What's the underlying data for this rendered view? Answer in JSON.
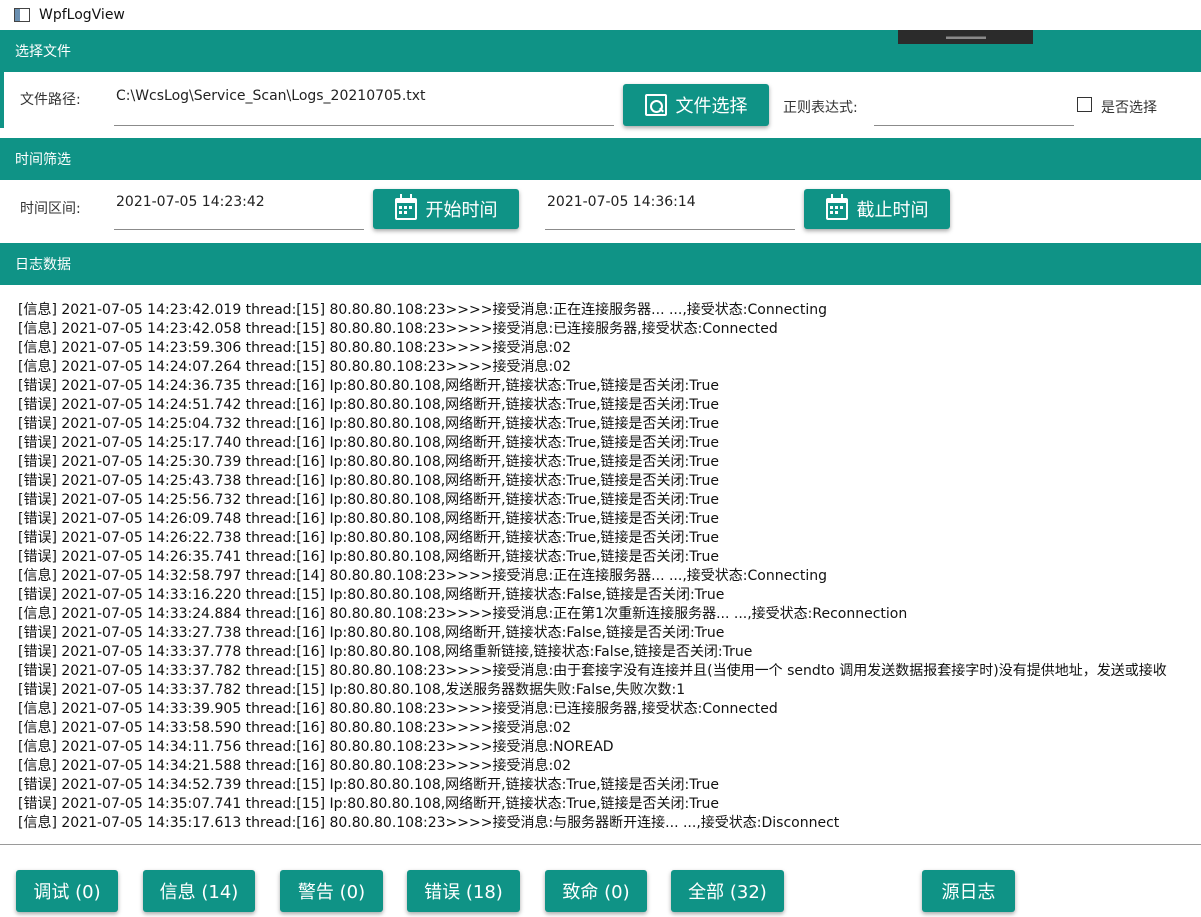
{
  "window": {
    "title": "WpfLogView"
  },
  "sections": {
    "file": "选择文件",
    "time": "时间筛选",
    "log": "日志数据"
  },
  "file_select": {
    "path_label": "文件路径:",
    "path_value": "C:\\WcsLog\\Service_Scan\\Logs_20210705.txt",
    "button": "文件选择",
    "regex_label": "正则表达式:",
    "regex_value": "",
    "checkbox_label": "是否选择"
  },
  "time_filter": {
    "range_label": "时间区间:",
    "start_value": "2021-07-05 14:23:42",
    "start_button": "开始时间",
    "end_value": "2021-07-05 14:36:14",
    "end_button": "截止时间"
  },
  "log_lines": [
    "[信息] 2021-07-05 14:23:42.019 thread:[15] 80.80.80.108:23>>>>接受消息:正在连接服务器... ...,接受状态:Connecting",
    "[信息] 2021-07-05 14:23:42.058 thread:[15] 80.80.80.108:23>>>>接受消息:已连接服务器,接受状态:Connected",
    "[信息] 2021-07-05 14:23:59.306 thread:[15] 80.80.80.108:23>>>>接受消息:02",
    "[信息] 2021-07-05 14:24:07.264 thread:[15] 80.80.80.108:23>>>>接受消息:02",
    "[错误] 2021-07-05 14:24:36.735 thread:[16] Ip:80.80.80.108,网络断开,链接状态:True,链接是否关闭:True",
    "[错误] 2021-07-05 14:24:51.742 thread:[16] Ip:80.80.80.108,网络断开,链接状态:True,链接是否关闭:True",
    "[错误] 2021-07-05 14:25:04.732 thread:[16] Ip:80.80.80.108,网络断开,链接状态:True,链接是否关闭:True",
    "[错误] 2021-07-05 14:25:17.740 thread:[16] Ip:80.80.80.108,网络断开,链接状态:True,链接是否关闭:True",
    "[错误] 2021-07-05 14:25:30.739 thread:[16] Ip:80.80.80.108,网络断开,链接状态:True,链接是否关闭:True",
    "[错误] 2021-07-05 14:25:43.738 thread:[16] Ip:80.80.80.108,网络断开,链接状态:True,链接是否关闭:True",
    "[错误] 2021-07-05 14:25:56.732 thread:[16] Ip:80.80.80.108,网络断开,链接状态:True,链接是否关闭:True",
    "[错误] 2021-07-05 14:26:09.748 thread:[16] Ip:80.80.80.108,网络断开,链接状态:True,链接是否关闭:True",
    "[错误] 2021-07-05 14:26:22.738 thread:[16] Ip:80.80.80.108,网络断开,链接状态:True,链接是否关闭:True",
    "[错误] 2021-07-05 14:26:35.741 thread:[16] Ip:80.80.80.108,网络断开,链接状态:True,链接是否关闭:True",
    "[信息] 2021-07-05 14:32:58.797 thread:[14] 80.80.80.108:23>>>>接受消息:正在连接服务器... ...,接受状态:Connecting",
    "[错误] 2021-07-05 14:33:16.220 thread:[15] Ip:80.80.80.108,网络断开,链接状态:False,链接是否关闭:True",
    "[信息] 2021-07-05 14:33:24.884 thread:[16] 80.80.80.108:23>>>>接受消息:正在第1次重新连接服务器... ...,接受状态:Reconnection",
    "[错误] 2021-07-05 14:33:27.738 thread:[16] Ip:80.80.80.108,网络断开,链接状态:False,链接是否关闭:True",
    "[错误] 2021-07-05 14:33:37.778 thread:[16] Ip:80.80.80.108,网络重新链接,链接状态:False,链接是否关闭:True",
    "[错误] 2021-07-05 14:33:37.782 thread:[15] 80.80.80.108:23>>>>接受消息:由于套接字没有连接并且(当使用一个 sendto 调用发送数据报套接字时)没有提供地址，发送或接收",
    "[错误] 2021-07-05 14:33:37.782 thread:[15] Ip:80.80.80.108,发送服务器数据失败:False,失败次数:1",
    "[信息] 2021-07-05 14:33:39.905 thread:[16] 80.80.80.108:23>>>>接受消息:已连接服务器,接受状态:Connected",
    "[信息] 2021-07-05 14:33:58.590 thread:[16] 80.80.80.108:23>>>>接受消息:02",
    "[信息] 2021-07-05 14:34:11.756 thread:[16] 80.80.80.108:23>>>>接受消息:NOREAD",
    "[信息] 2021-07-05 14:34:21.588 thread:[16] 80.80.80.108:23>>>>接受消息:02",
    "[错误] 2021-07-05 14:34:52.739 thread:[15] Ip:80.80.80.108,网络断开,链接状态:True,链接是否关闭:True",
    "[错误] 2021-07-05 14:35:07.741 thread:[15] Ip:80.80.80.108,网络断开,链接状态:True,链接是否关闭:True",
    "[信息] 2021-07-05 14:35:17.613 thread:[16] 80.80.80.108:23>>>>接受消息:与服务器断开连接... ...,接受状态:Disconnect"
  ],
  "filters": [
    "调试 (0)",
    "信息 (14)",
    "警告 (0)",
    "错误 (18)",
    "致命 (0)",
    "全部 (32)",
    "源日志"
  ],
  "colors": {
    "accent": "#0f9386"
  }
}
